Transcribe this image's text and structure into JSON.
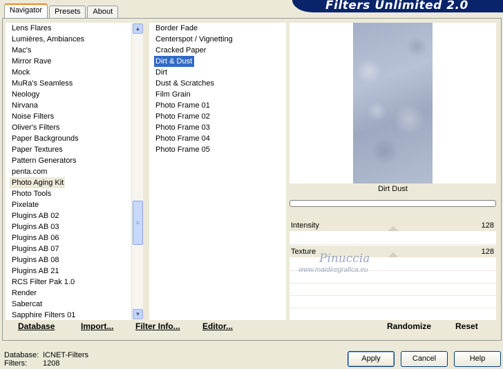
{
  "banner": "Filters Unlimited 2.0",
  "tabs": [
    "Navigator",
    "Presets",
    "About"
  ],
  "categories": [
    "Lens Flares",
    "Lumières, Ambiances",
    "Mac's",
    "Mirror Rave",
    "Mock",
    "MuRa's Seamless",
    "Neology",
    "Nirvana",
    "Noise Filters",
    "Oliver's Filters",
    "Paper Backgrounds",
    "Paper Textures",
    "Pattern Generators",
    "penta.com",
    "Photo Aging Kit",
    "Photo Tools",
    "Pixelate",
    "Plugins AB 02",
    "Plugins AB 03",
    "Plugins AB 06",
    "Plugins AB 07",
    "Plugins AB 08",
    "Plugins AB 21",
    "RCS Filter Pak 1.0",
    "Render",
    "Sabercat",
    "Sapphire Filters 01"
  ],
  "selected_category": "Photo Aging Kit",
  "filters": [
    "Border Fade",
    "Centerspot / Vignetting",
    "Cracked Paper",
    "Dirt & Dust",
    "Dirt",
    "Dust & Scratches",
    "Film Grain",
    "Photo Frame 01",
    "Photo Frame 02",
    "Photo Frame 03",
    "Photo Frame 04",
    "Photo Frame 05"
  ],
  "selected_filter": "Dirt & Dust",
  "preview_caption": "Dirt  Dust",
  "params": {
    "intensity": {
      "label": "Intensity",
      "value": "128"
    },
    "texture": {
      "label": "Texture",
      "value": "128"
    }
  },
  "watermark": {
    "name": "Pinuccia",
    "url": "www.maidiregrafica.eu"
  },
  "toolbar": {
    "database": "Database",
    "import": "Import...",
    "filter_info": "Filter Info...",
    "editor": "Editor...",
    "randomize": "Randomize",
    "reset": "Reset"
  },
  "status": {
    "db_label": "Database:",
    "db_value": "ICNET-Filters",
    "filters_label": "Filters:",
    "filters_value": "1208"
  },
  "buttons": {
    "apply": "Apply",
    "cancel": "Cancel",
    "help": "Help"
  }
}
